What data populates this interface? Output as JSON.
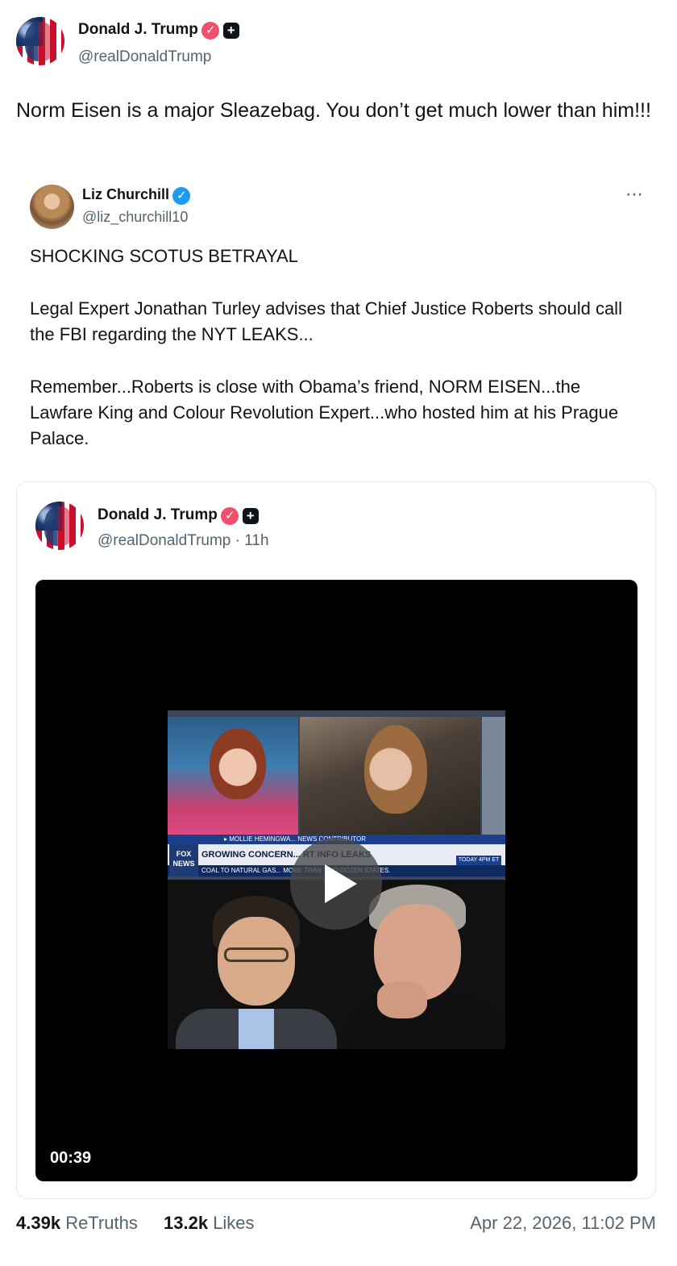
{
  "post": {
    "author_name": "Donald J. Trump",
    "author_handle": "@realDonaldTrump",
    "text": "Norm Eisen is a major Sleazebag. You don’t get much lower than him!!!"
  },
  "quote": {
    "author_name": "Liz Churchill",
    "author_handle": "@liz_churchill10",
    "more_icon": "more-horizontal-icon",
    "paragraphs": [
      "SHOCKING SCOTUS BETRAYAL",
      "Legal Expert Jonathan Turley advises that Chief Justice Roberts should call the FBI regarding the NYT LEAKS...",
      "Remember...Roberts is close with Obama’s friend, NORM EISEN...the Lawfare King and Colour Revolution Expert...who hosted him at his Prague Palace."
    ],
    "embed": {
      "author_name": "Donald J. Trump",
      "author_handle_time": "@realDonaldTrump · 11h",
      "video": {
        "duration": "00:39",
        "chyron_top": "▸ MOLLIE HEMINGWA... NEWS CONTRIBUTOR",
        "chyron_main": "GROWING CONCERN... RT INFO LEAKS",
        "chyron_bottom": "COAL TO NATURAL GAS... MORE THAN TWO DOZEN STATES.",
        "fox_logo": "FOX NEWS",
        "today_tag": "TODAY 4PM ET"
      }
    }
  },
  "stats": {
    "retruths_count": "4.39k",
    "retruths_label": "ReTruths",
    "likes_count": "13.2k",
    "likes_label": "Likes",
    "timestamp": "Apr 22, 2026, 11:02 PM"
  },
  "colors": {
    "text": "#0f1419",
    "muted": "#536471",
    "verified_pink": "#f0506e",
    "verified_blue": "#1d9bf0",
    "border": "#e6e9ec"
  }
}
